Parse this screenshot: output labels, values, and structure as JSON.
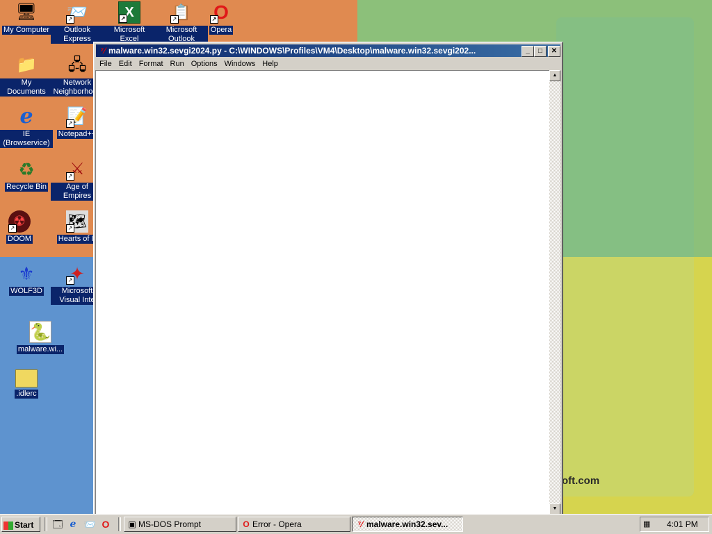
{
  "desktop": {
    "icons": [
      {
        "label": "My Computer",
        "glyph": "🖥"
      },
      {
        "label": "Outlook Express",
        "glyph": "📨"
      },
      {
        "label": "Microsoft Excel",
        "glyph": "X"
      },
      {
        "label": "Microsoft Outlook",
        "glyph": "📋"
      },
      {
        "label": "Opera",
        "glyph": "O"
      },
      {
        "label": "My Documents",
        "glyph": "📁"
      },
      {
        "label": "Network Neighborhood",
        "glyph": "🖧"
      },
      {
        "label": "IE (Browservice)",
        "glyph": "e"
      },
      {
        "label": "Notepad++",
        "glyph": "📝"
      },
      {
        "label": "Recycle Bin",
        "glyph": "♻"
      },
      {
        "label": "Age of Empires",
        "glyph": "⚔"
      },
      {
        "label": "DOOM",
        "glyph": "☢"
      },
      {
        "label": "Hearts of Ir",
        "glyph": "🗺"
      },
      {
        "label": "WOLF3D",
        "glyph": "⚜"
      },
      {
        "label": "Microsoft Visual Inte",
        "glyph": "✦"
      },
      {
        "label": "malware.wi...",
        "glyph": "🐍"
      },
      {
        "label": ".idlerc",
        "glyph": "📁"
      }
    ],
    "wallpaper_text": "oft.com"
  },
  "window": {
    "title": "malware.win32.sevgi2024.py - C:\\WINDOWS\\Profiles\\VM4\\Desktop\\malware.win32.sevgi202...",
    "menu": [
      "File",
      "Edit",
      "Format",
      "Run",
      "Options",
      "Windows",
      "Help"
    ],
    "buttons": {
      "minimize": "_",
      "maximize": "□",
      "close": "✕"
    }
  },
  "taskbar": {
    "start_label": "Start",
    "tasks": [
      {
        "label": "MS-DOS Prompt",
        "icon": "msdos-icon"
      },
      {
        "label": "Error - Opera",
        "icon": "opera-icon"
      },
      {
        "label": "malware.win32.sev...",
        "icon": "python-idle-icon"
      }
    ],
    "clock": "4:01 PM"
  },
  "colors": {
    "title_active": "#0a246a",
    "selection": "#0a246a",
    "face": "#d4d0c8"
  }
}
